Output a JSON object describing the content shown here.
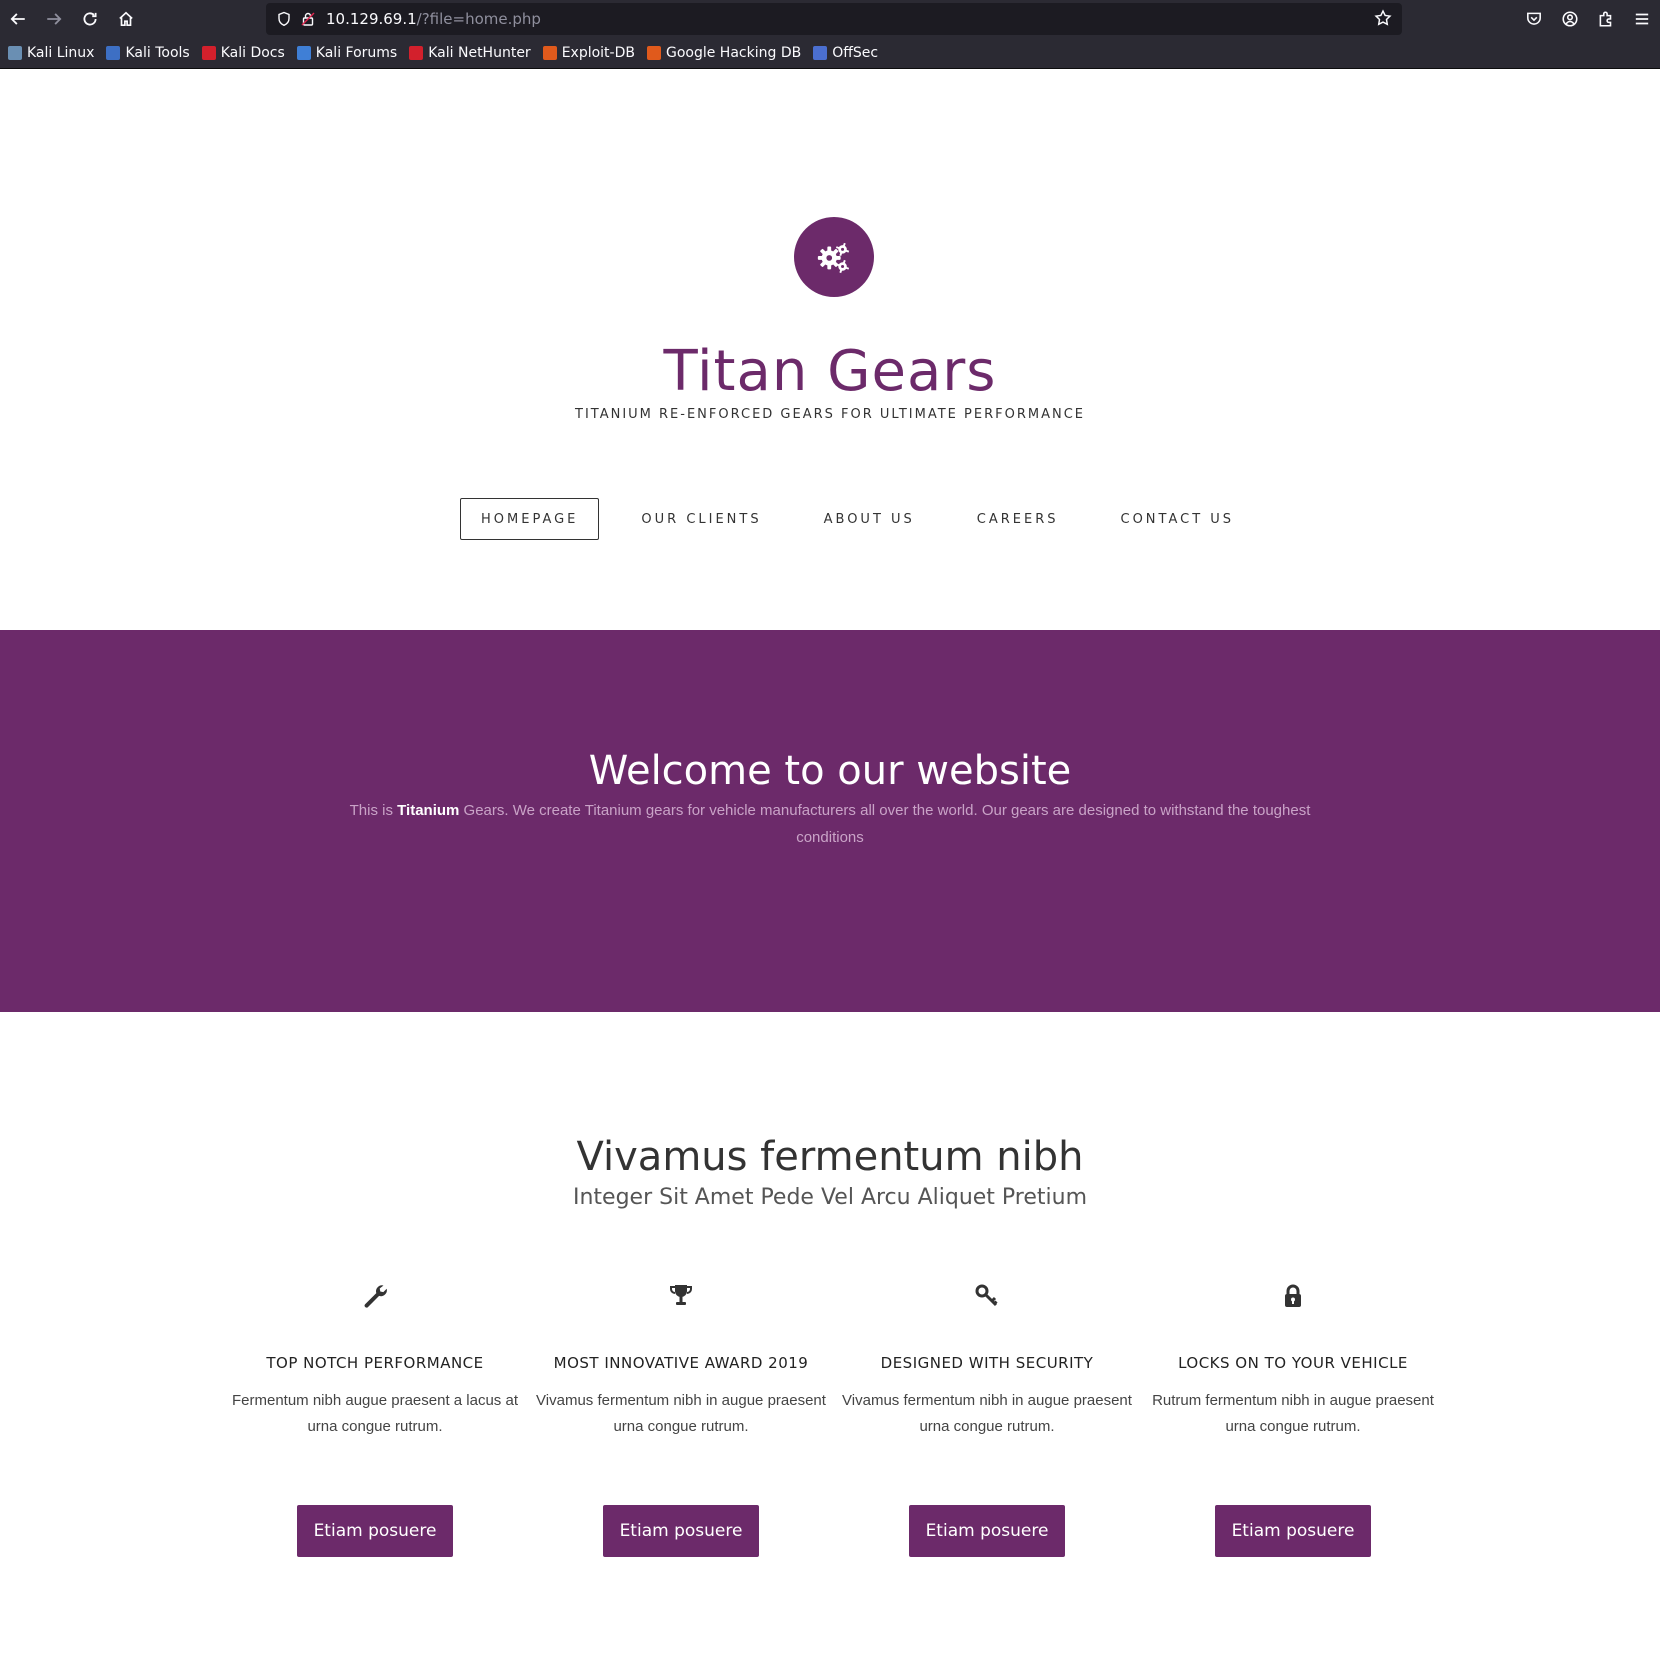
{
  "browser": {
    "url_host": "10.129.69.1",
    "url_path": "/?file=home.php",
    "bookmarks": [
      {
        "label": "Kali Linux",
        "color": "#6a8fb3"
      },
      {
        "label": "Kali Tools",
        "color": "#3d6fc4"
      },
      {
        "label": "Kali Docs",
        "color": "#d3202c"
      },
      {
        "label": "Kali Forums",
        "color": "#3f7fd6"
      },
      {
        "label": "Kali NetHunter",
        "color": "#d3202c"
      },
      {
        "label": "Exploit-DB",
        "color": "#e05a1c"
      },
      {
        "label": "Google Hacking DB",
        "color": "#e05a1c"
      },
      {
        "label": "OffSec",
        "color": "#4b6fd0"
      }
    ]
  },
  "header": {
    "title": "Titan Gears",
    "tagline": "TITANIUM RE-ENFORCED GEARS FOR ULTIMATE PERFORMANCE",
    "logo_icon": "gears-icon"
  },
  "nav": {
    "items": [
      {
        "label": "HOMEPAGE",
        "active": true
      },
      {
        "label": "OUR CLIENTS",
        "active": false
      },
      {
        "label": "ABOUT US",
        "active": false
      },
      {
        "label": "CAREERS",
        "active": false
      },
      {
        "label": "CONTACT US",
        "active": false
      }
    ]
  },
  "banner": {
    "heading": "Welcome to our website",
    "text_before": "This is ",
    "text_strong": "Titanium",
    "text_after": " Gears. We create Titanium gears for vehicle manufacturers all over the world. Our gears are designed to withstand the toughest conditions"
  },
  "features": {
    "heading": "Vivamus fermentum nibh",
    "subheading": "Integer Sit Amet Pede Vel Arcu Aliquet Pretium",
    "items": [
      {
        "icon": "wrench-icon",
        "title": "TOP NOTCH PERFORMANCE",
        "text": "Fermentum nibh augue praesent a lacus at urna congue rutrum.",
        "button": "Etiam posuere"
      },
      {
        "icon": "trophy-icon",
        "title": "MOST INNOVATIVE AWARD 2019",
        "text": "Vivamus fermentum nibh in augue praesent urna congue rutrum.",
        "button": "Etiam posuere"
      },
      {
        "icon": "key-icon",
        "title": "DESIGNED WITH SECURITY",
        "text": "Vivamus fermentum nibh in augue praesent urna congue rutrum.",
        "button": "Etiam posuere"
      },
      {
        "icon": "lock-icon",
        "title": "LOCKS ON TO YOUR VEHICLE",
        "text": "Rutrum fermentum nibh in augue praesent urna congue rutrum.",
        "button": "Etiam posuere"
      }
    ]
  },
  "colors": {
    "brand": "#6c2a6a",
    "chrome": "#2b2a33",
    "urlbar": "#1c1b22"
  }
}
